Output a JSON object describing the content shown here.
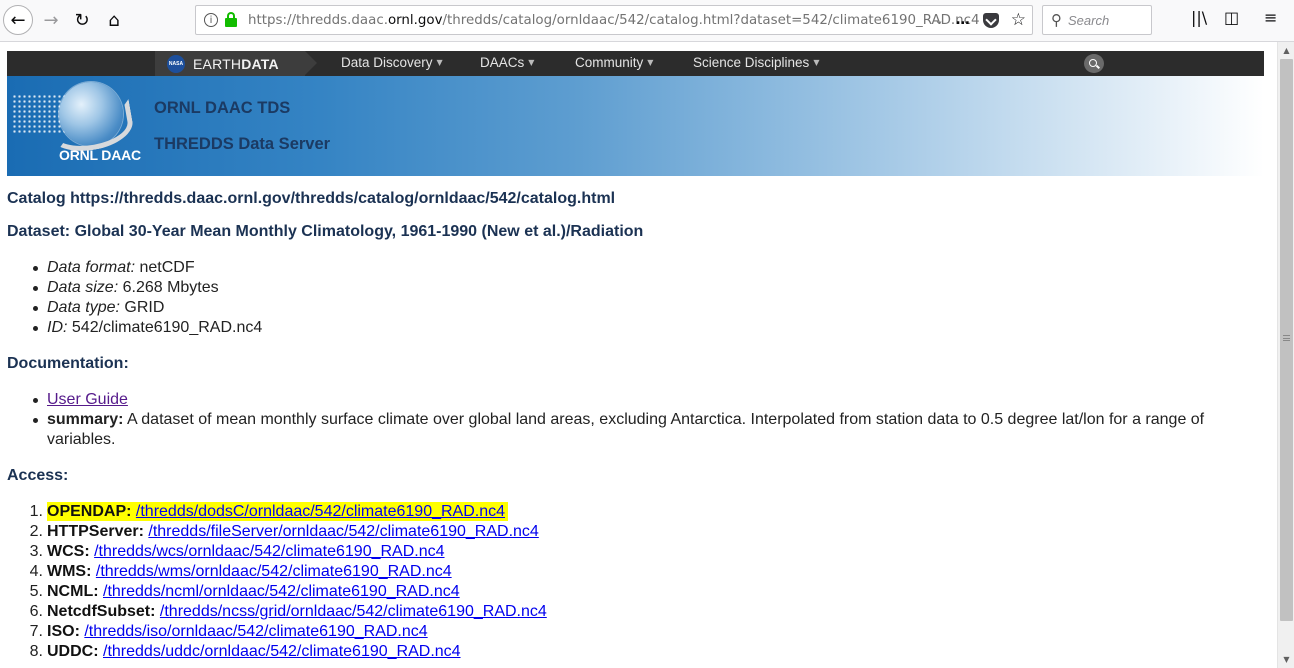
{
  "browser": {
    "url_prefix": "https://thredds.daac.",
    "url_domain": "ornl.gov",
    "url_suffix": "/thredds/catalog/ornldaac/542/catalog.html?dataset=542/climate6190_RAD.nc4",
    "search_placeholder": "Search",
    "icons": [
      "back-icon",
      "forward-icon",
      "reload-icon",
      "home-icon",
      "info-icon",
      "lock-icon",
      "pocket-icon",
      "bookmark-star-icon",
      "library-icon",
      "sidebar-icon",
      "menu-icon"
    ]
  },
  "earthdata": {
    "brand_light": "EARTH",
    "brand_bold": "DATA",
    "nasa_label": "NASA",
    "menu": [
      "Data Discovery",
      "DAACs",
      "Community",
      "Science Disciplines"
    ]
  },
  "banner": {
    "logo_text": "ORNL DAAC",
    "title": "ORNL DAAC TDS",
    "subtitle": "THREDDS Data Server"
  },
  "catalog": {
    "heading": "Catalog https://thredds.daac.ornl.gov/thredds/catalog/ornldaac/542/catalog.html",
    "dataset_heading": "Dataset: Global 30-Year Mean Monthly Climatology, 1961-1990 (New et al.)/Radiation",
    "info": [
      {
        "label": "Data format:",
        "value": "netCDF"
      },
      {
        "label": "Data size:",
        "value": "6.268 Mbytes"
      },
      {
        "label": "Data type:",
        "value": "GRID"
      },
      {
        "label": "ID:",
        "value": "542/climate6190_RAD.nc4"
      }
    ],
    "documentation_heading": "Documentation:",
    "user_guide": "User Guide",
    "summary_label": "summary:",
    "summary_text": "A dataset of mean monthly surface climate over global land areas, excluding Antarctica. Interpolated from station data to 0.5 degree lat/lon for a range of variables.",
    "access_heading": "Access:",
    "access": [
      {
        "num": "1.",
        "service": "OPENDAP:",
        "path": "/thredds/dodsC/ornldaac/542/climate6190_RAD.nc4"
      },
      {
        "num": "2.",
        "service": "HTTPServer:",
        "path": "/thredds/fileServer/ornldaac/542/climate6190_RAD.nc4"
      },
      {
        "num": "3.",
        "service": "WCS:",
        "path": "/thredds/wcs/ornldaac/542/climate6190_RAD.nc4"
      },
      {
        "num": "4.",
        "service": "WMS:",
        "path": "/thredds/wms/ornldaac/542/climate6190_RAD.nc4"
      },
      {
        "num": "5.",
        "service": "NCML:",
        "path": "/thredds/ncml/ornldaac/542/climate6190_RAD.nc4"
      },
      {
        "num": "6.",
        "service": "NetcdfSubset:",
        "path": "/thredds/ncss/grid/ornldaac/542/climate6190_RAD.nc4"
      },
      {
        "num": "7.",
        "service": "ISO:",
        "path": "/thredds/iso/ornldaac/542/climate6190_RAD.nc4"
      },
      {
        "num": "8.",
        "service": "UDDC:",
        "path": "/thredds/uddc/ornldaac/542/climate6190_RAD.nc4"
      }
    ]
  },
  "colors": {
    "heading": "#1b3253",
    "link": "#0000ee",
    "visited_link": "#551a8b",
    "highlight": "#ffff00",
    "earthdata_bar": "#2c2c2c",
    "banner_blue": "#1a6cb3"
  }
}
